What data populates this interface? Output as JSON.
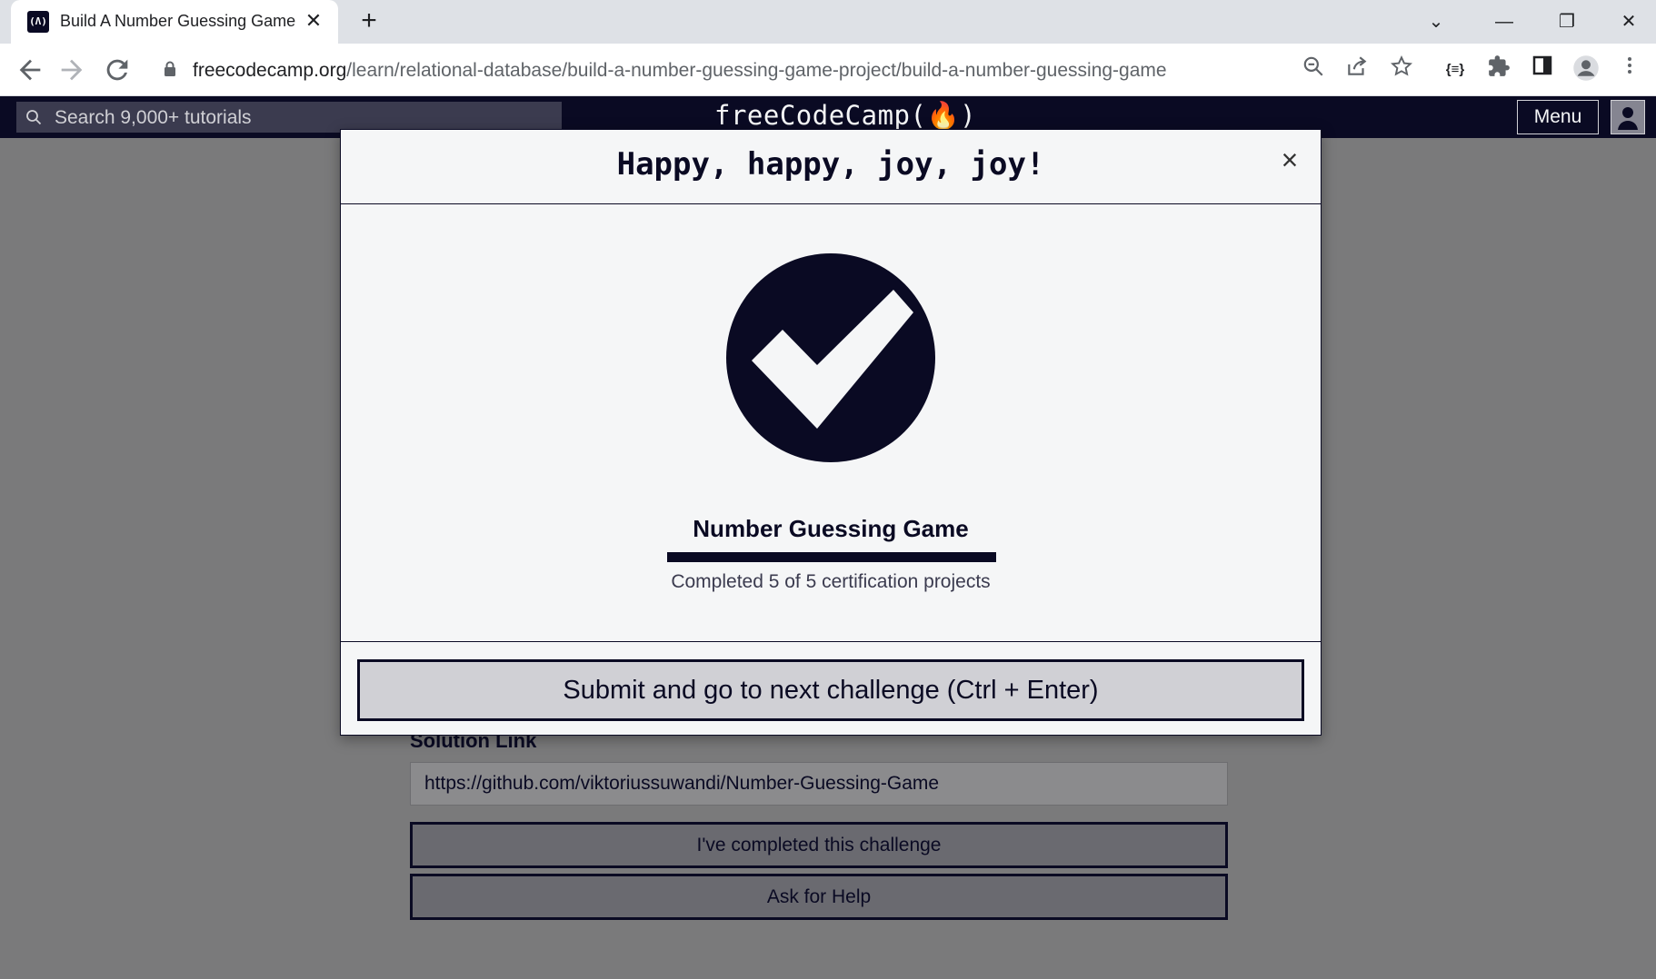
{
  "browser": {
    "tab_title": "Build A Number Guessing Game",
    "favicon_text": "(Λ)",
    "tab_close": "✕",
    "new_tab": "+",
    "url_host": "freecodecamp.org",
    "url_path": "/learn/relational-database/build-a-number-guessing-game-project/build-a-number-guessing-game",
    "window_controls": {
      "dropdown": "⌄",
      "minimize": "—",
      "restore": "❐",
      "close": "✕"
    }
  },
  "fcc_nav": {
    "search_placeholder": "Search 9,000+ tutorials",
    "logo": "freeCodeCamp(🔥)",
    "menu_label": "Menu"
  },
  "background_page": {
    "solution_label": "Solution Link",
    "solution_value": "https://github.com/viktoriussuwandi/Number-Guessing-Game",
    "complete_button": "I've completed this challenge",
    "help_button": "Ask for Help"
  },
  "modal": {
    "title": "Happy, happy, joy, joy!",
    "close": "×",
    "project_name": "Number Guessing Game",
    "progress_text": "Completed 5 of 5 certification projects",
    "progress_completed": 5,
    "progress_total": 5,
    "submit_button": "Submit and go to next challenge (Ctrl + Enter)"
  },
  "colors": {
    "fcc_dark": "#0a0a23",
    "modal_bg": "#f5f6f7",
    "button_bg": "#d0d0d5",
    "overlay": "#7a7a7b"
  }
}
